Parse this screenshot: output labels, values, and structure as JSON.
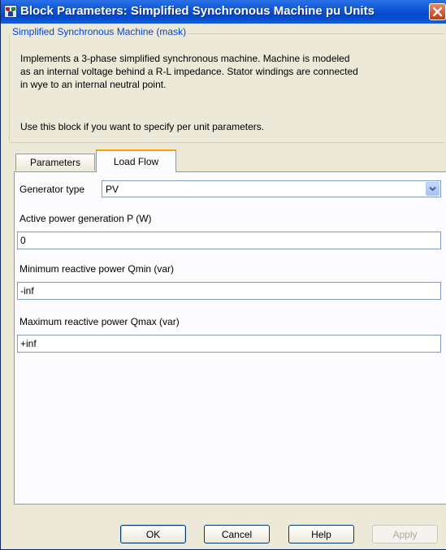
{
  "window": {
    "title": "Block Parameters: Simplified Synchronous Machine pu Units",
    "close_icon": "close-icon"
  },
  "group": {
    "legend": "Simplified Synchronous Machine (mask)",
    "description": "Implements a 3-phase simplified synchronous machine. Machine is modeled\nas an internal voltage behind a R-L impedance. Stator windings are connected\nin wye to an internal neutral point.",
    "usage": "Use this block if you want to specify per unit parameters."
  },
  "tabs": [
    {
      "label": "Parameters",
      "selected": false
    },
    {
      "label": "Load Flow",
      "selected": true
    }
  ],
  "load_flow": {
    "generator_type_label": "Generator type",
    "generator_type_value": "PV",
    "active_power_label": "Active power generation P (W)",
    "active_power_value": "0",
    "qmin_label": "Minimum reactive power Qmin (var)",
    "qmin_value": "-inf",
    "qmax_label": "Maximum reactive power Qmax (var)",
    "qmax_value": "+inf"
  },
  "buttons": {
    "ok": "OK",
    "cancel": "Cancel",
    "help": "Help",
    "apply": "Apply"
  },
  "colors": {
    "titlebar": "#0a54d4",
    "close": "#d6552f",
    "active_tab_accent": "#ff9900",
    "legend_text": "#0046d5"
  }
}
